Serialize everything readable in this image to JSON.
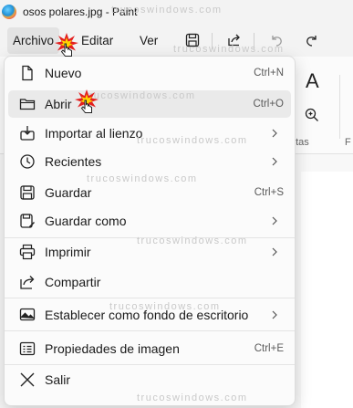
{
  "title": {
    "text": "osos polares.jpg - Paint"
  },
  "menubar": {
    "tabs": [
      "Archivo",
      "Editar",
      "Ver"
    ],
    "tools": [
      "save-icon",
      "share-icon",
      "undo-icon",
      "redo-icon"
    ]
  },
  "ribbon": {
    "text_tool": "A",
    "group_label": "ntas",
    "group_label2": "F"
  },
  "file_menu": {
    "items": [
      {
        "label": "Nuevo",
        "shortcut": "Ctrl+N",
        "icon": "new-file-icon"
      },
      {
        "label": "Abrir",
        "shortcut": "Ctrl+O",
        "icon": "folder-icon"
      },
      {
        "label": "Importar al lienzo",
        "icon": "import-icon"
      },
      {
        "label": "Recientes",
        "icon": "clock-icon"
      },
      {
        "label": "Guardar",
        "shortcut": "Ctrl+S",
        "icon": "save-icon"
      },
      {
        "label": "Guardar como",
        "icon": "save-as-icon"
      },
      {
        "label": "Imprimir",
        "icon": "printer-icon"
      },
      {
        "label": "Compartir",
        "icon": "share-icon"
      },
      {
        "label": "Establecer como fondo de escritorio",
        "icon": "wallpaper-icon"
      },
      {
        "label": "Propiedades de imagen",
        "shortcut": "Ctrl+E",
        "icon": "properties-icon"
      },
      {
        "label": "Salir",
        "icon": "close-icon"
      }
    ]
  },
  "watermark": {
    "text": "trucoswindows.com"
  }
}
